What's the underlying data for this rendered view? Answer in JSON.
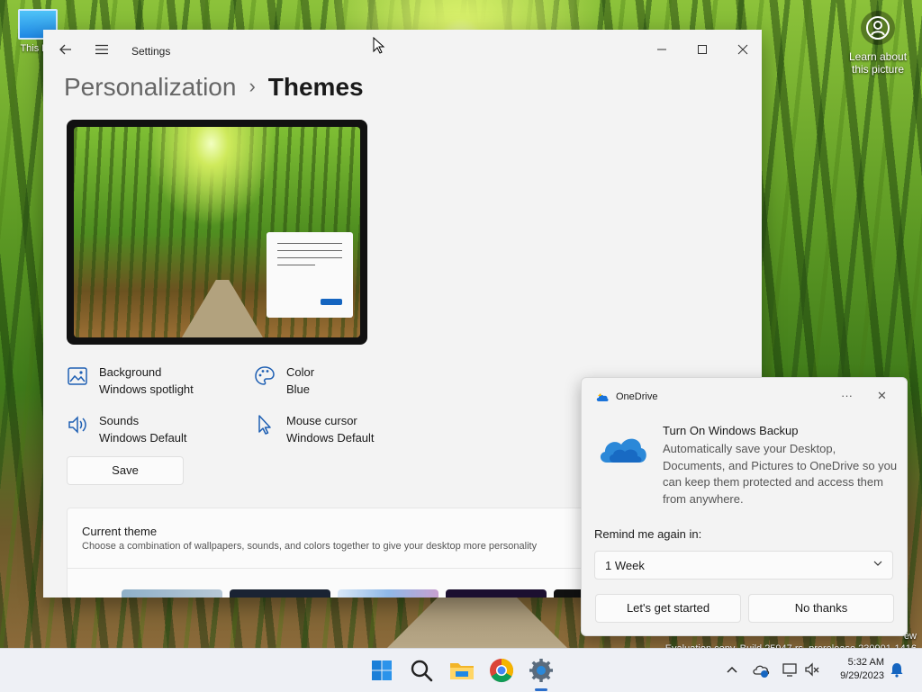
{
  "desktop": {
    "icon_label": "This PC",
    "learn_label": "Learn about this picture",
    "watermark_line1": "ew",
    "watermark_line2": "Evaluation copy. Build 25947.rs_prerelease.230901-1416"
  },
  "settings": {
    "app_title": "Settings",
    "breadcrumb_parent": "Personalization",
    "breadcrumb_sep": "›",
    "breadcrumb_current": "Themes",
    "props": {
      "background_label": "Background",
      "background_value": "Windows spotlight",
      "color_label": "Color",
      "color_value": "Blue",
      "sounds_label": "Sounds",
      "sounds_value": "Windows Default",
      "cursor_label": "Mouse cursor",
      "cursor_value": "Windows Default"
    },
    "save_label": "Save",
    "current_theme_title": "Current theme",
    "current_theme_desc": "Choose a combination of wallpapers, sounds, and colors together to give your desktop more personality"
  },
  "toast": {
    "app_name": "OneDrive",
    "more_glyph": "···",
    "close_glyph": "✕",
    "title": "Turn On Windows Backup",
    "body": "Automatically save your Desktop, Documents, and Pictures to OneDrive so you can keep them protected and access them from anywhere.",
    "remind_label": "Remind me again in:",
    "remind_value": "1 Week",
    "primary_button": "Let's get started",
    "secondary_button": "No thanks"
  },
  "taskbar": {
    "time": "5:32 AM",
    "date": "9/29/2023"
  },
  "colors": {
    "accent": "#0067c0",
    "windows_blue": "#0078d4"
  }
}
